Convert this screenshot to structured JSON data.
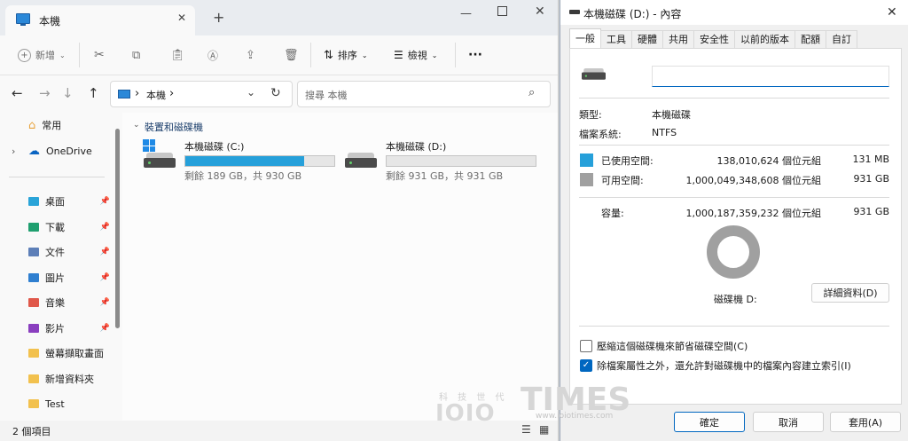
{
  "explorer": {
    "tab_title": "本機",
    "new_tab_symbol": "+",
    "toolbar": {
      "new_label": "新增",
      "sort_label": "排序",
      "view_label": "檢視",
      "more_label": "···"
    },
    "address": {
      "chevron1": "›",
      "path": "本機",
      "chevron2": "›",
      "search_placeholder": "搜尋 本機"
    },
    "nav": {
      "home": "常用",
      "onedrive": "OneDrive",
      "items": [
        {
          "label": "桌面",
          "icon": "desktop-icon",
          "color": "#2aa4d8"
        },
        {
          "label": "下載",
          "icon": "download-icon",
          "color": "#1f9f6f"
        },
        {
          "label": "文件",
          "icon": "document-icon",
          "color": "#5d7fb8"
        },
        {
          "label": "圖片",
          "icon": "pictures-icon",
          "color": "#2f7fd0"
        },
        {
          "label": "音樂",
          "icon": "music-icon",
          "color": "#e0584a"
        },
        {
          "label": "影片",
          "icon": "video-icon",
          "color": "#8a3fbf"
        },
        {
          "label": "螢幕擷取畫面",
          "icon": "folder-icon",
          "color": "#f2c14e"
        },
        {
          "label": "新增資料夾",
          "icon": "folder-icon",
          "color": "#f2c14e"
        },
        {
          "label": "Test",
          "icon": "folder-icon",
          "color": "#f2c14e"
        }
      ],
      "pin_symbol": "📌"
    },
    "section_header": "裝置和磁碟機",
    "drives": [
      {
        "name": "本機磁碟 (C:)",
        "free_text": "剩餘 189 GB，共 930 GB",
        "used_fraction": 0.797
      },
      {
        "name": "本機磁碟 (D:)",
        "free_text": "剩餘 931 GB，共 931 GB",
        "used_fraction": 0.0
      }
    ],
    "status": "2 個項目"
  },
  "props": {
    "title": "本機磁碟 (D:) - 內容",
    "close_symbol": "✕",
    "tabs": [
      "一般",
      "工具",
      "硬體",
      "共用",
      "安全性",
      "以前的版本",
      "配額",
      "自訂"
    ],
    "name_value": "",
    "type_label": "類型:",
    "type_value": "本機磁碟",
    "fs_label": "檔案系統:",
    "fs_value": "NTFS",
    "used_label": "已使用空間:",
    "used_bytes": "138,010,624 個位元組",
    "used_size": "131 MB",
    "free_label": "可用空間:",
    "free_bytes": "1,000,049,348,608 個位元組",
    "free_size": "931 GB",
    "cap_label": "容量:",
    "cap_bytes": "1,000,187,359,232 個位元組",
    "cap_size": "931 GB",
    "drive_label": "磁碟機 D:",
    "details_button": "詳細資料(D)",
    "compress_label": "壓縮這個磁碟機來節省磁碟空間(C)",
    "index_label": "除檔案屬性之外，還允許對磁碟機中的檔案內容建立索引(I)",
    "compress_checked": false,
    "index_checked": true,
    "ok": "確定",
    "cancel": "取消",
    "apply": "套用(A)",
    "used_fraction": 0.000138,
    "used_color": "#26a0da",
    "free_color": "#a0a0a0"
  },
  "watermark": {
    "chinese": "科 技 世 代",
    "brand": "TIMES",
    "logo_text": "IOIO",
    "url": "www.ioiotimes.com"
  }
}
